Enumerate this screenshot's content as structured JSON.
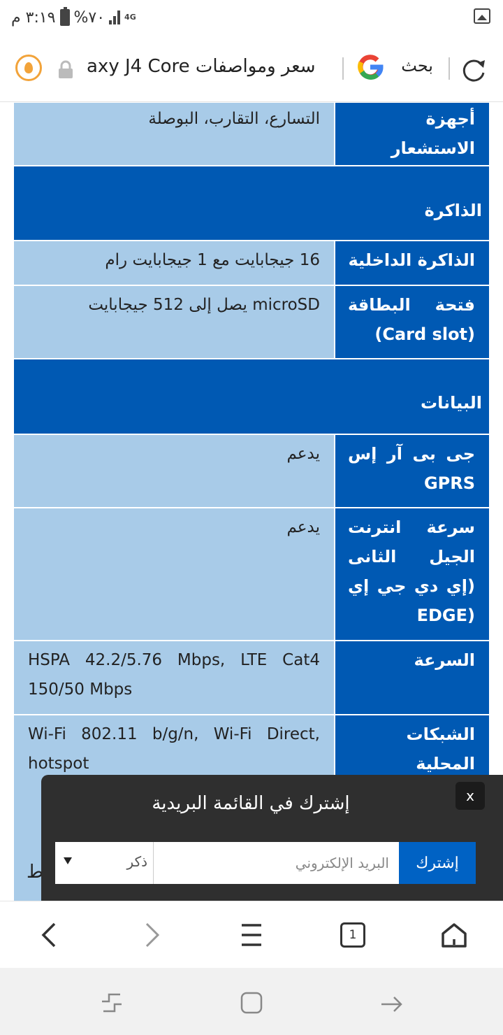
{
  "status_bar": {
    "time": "٣:١٩ م",
    "battery": "%٧٠",
    "network": "4G"
  },
  "address_bar": {
    "search_label": "بحث",
    "url_title": "سعر ومواصفات axy J4 Core"
  },
  "spec_table": {
    "rows": [
      {
        "type": "spec",
        "label": "أجهزة الاستشعار",
        "value": "التسارع، التقارب، البوصلة"
      },
      {
        "type": "section",
        "label": "الذاكرة"
      },
      {
        "type": "spec",
        "label": "الذاكرة الداخلية",
        "value": "16 جيجابايت مع 1 جيجابايت رام"
      },
      {
        "type": "spec",
        "label": "فتحة البطاقة (Card slot)",
        "value": "microSD يصل إلى 512 جيجابايت"
      },
      {
        "type": "section",
        "label": "البيانات"
      },
      {
        "type": "spec",
        "label": "جى بى آر إس GPRS",
        "value": "يدعم"
      },
      {
        "type": "spec",
        "label": "سرعة انترنت الجيل الثانى (إي دي جي إي (EDGE",
        "value": "يدعم"
      },
      {
        "type": "spec",
        "label": "السرعة",
        "value": "HSPA 42.2/5.76 Mbps, LTE Cat4 150/50 Mbps"
      },
      {
        "type": "spec",
        "label": "الشبكات المحلية",
        "value": "Wi-Fi 802.11 b/g/n, Wi-Fi Direct, hotspot"
      }
    ]
  },
  "subscribe_popup": {
    "title": "إشترك في القائمة البريدية",
    "close_label": "x",
    "submit_label": "إشترك",
    "email_placeholder": "البريد الإلكتروني",
    "gender_selected": "ذكر"
  },
  "partial_text": "ط",
  "browser_nav": {
    "tab_count": "1",
    "icons": [
      "back-icon",
      "forward-icon",
      "menu-icon",
      "tabs-icon",
      "home-icon"
    ]
  },
  "system_nav": {
    "icons": [
      "recent-apps-icon",
      "home-button-icon",
      "back-arrow-icon"
    ]
  }
}
